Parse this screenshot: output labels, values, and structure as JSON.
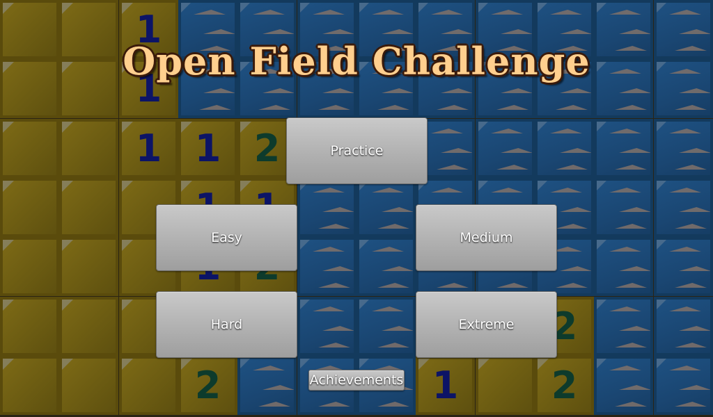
{
  "title": "Open Field Challenge",
  "buttons": {
    "practice": "Practice",
    "easy": "Easy",
    "medium": "Medium",
    "hard": "Hard",
    "extreme": "Extreme",
    "achievements": "Achievements"
  },
  "colors": {
    "number_1": "#0c1466",
    "number_2": "#0d3b2c",
    "revealed_tile": "#6c5c12",
    "hidden_tile": "#1a4672",
    "title_fill": "#ffcf8e",
    "title_outline": "#3a1a0a",
    "button_face": "#b3b3b3"
  },
  "board": {
    "columns": 12,
    "rows": 7,
    "tiles": [
      [
        "R",
        "R",
        "R1",
        "H",
        "H",
        "H",
        "H",
        "H",
        "H",
        "H",
        "H",
        "H"
      ],
      [
        "R",
        "R",
        "R1",
        "H",
        "H",
        "H",
        "H",
        "H",
        "H",
        "H",
        "H",
        "H"
      ],
      [
        "R",
        "R",
        "R1",
        "R1",
        "R2",
        "H",
        "H",
        "H",
        "H",
        "H",
        "H",
        "H"
      ],
      [
        "R",
        "R",
        "R",
        "R1",
        "R1",
        "H",
        "H",
        "H",
        "H",
        "H",
        "H",
        "H"
      ],
      [
        "R",
        "R",
        "R",
        "R1",
        "R2",
        "H",
        "H",
        "H",
        "H",
        "H",
        "H",
        "H"
      ],
      [
        "R",
        "R",
        "R",
        "R",
        "R",
        "H",
        "H",
        "H",
        "H",
        "R2",
        "H",
        "H"
      ],
      [
        "R",
        "R",
        "R",
        "R2",
        "H",
        "H",
        "H",
        "R1",
        "R",
        "R2",
        "H",
        "H"
      ]
    ]
  }
}
